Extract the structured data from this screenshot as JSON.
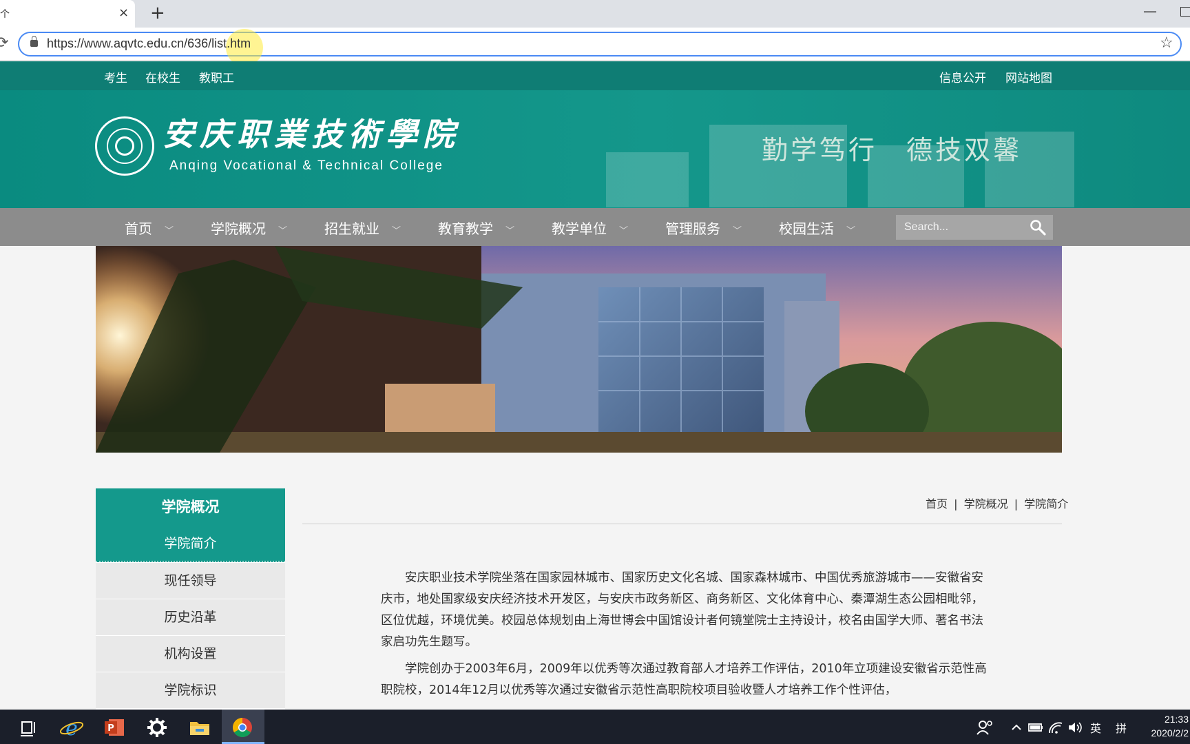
{
  "browser": {
    "tab_title": "个",
    "close_glyph": "×",
    "new_tab_glyph": "+",
    "url": "https://www.aqvtc.edu.cn/636/list.htm",
    "minimize_glyph": "—",
    "reload_glyph": "⟳",
    "star_glyph": "☆"
  },
  "topbar": {
    "left_links": [
      "考生",
      "在校生",
      "教职工"
    ],
    "right_links": [
      "信息公开",
      "网站地图"
    ]
  },
  "header": {
    "logo_cn": "安庆职業技術學院",
    "logo_en": "Anqing Vocational & Technical College",
    "motto": "勤学笃行　德技双馨"
  },
  "nav": {
    "items": [
      "首页",
      "学院概况",
      "招生就业",
      "教育教学",
      "教学单位",
      "管理服务",
      "校园生活"
    ],
    "chevron": "﹀",
    "search_placeholder": "Search..."
  },
  "sidebar": {
    "title": "学院概况",
    "items": [
      "学院简介",
      "现任领导",
      "历史沿革",
      "机构设置",
      "学院标识"
    ],
    "active_index": 0
  },
  "breadcrumb": {
    "items": [
      "首页",
      "学院概况",
      "学院简介"
    ],
    "separator": "|"
  },
  "article": {
    "paragraphs": [
      "安庆职业技术学院坐落在国家园林城市、国家历史文化名城、国家森林城市、中国优秀旅游城市——安徽省安庆市，地处国家级安庆经济技术开发区，与安庆市政务新区、商务新区、文化体育中心、秦潭湖生态公园相毗邻，区位优越，环境优美。校园总体规划由上海世博会中国馆设计者何镜堂院士主持设计，校名由国学大师、著名书法家启功先生题写。",
      "学院创办于2003年6月，2009年以优秀等次通过教育部人才培养工作评估，2010年立项建设安徽省示范性高职院校，2014年12月以优秀等次通过安徽省示范性高职院校项目验收暨人才培养工作个性评估，"
    ]
  },
  "taskbar": {
    "tray": [
      "英",
      "拼"
    ],
    "time": "21:33",
    "date": "2020/2/2"
  },
  "colors": {
    "teal": "#0f7d74",
    "teal_light": "#14998c",
    "nav_gray": "#8c8c8c"
  }
}
